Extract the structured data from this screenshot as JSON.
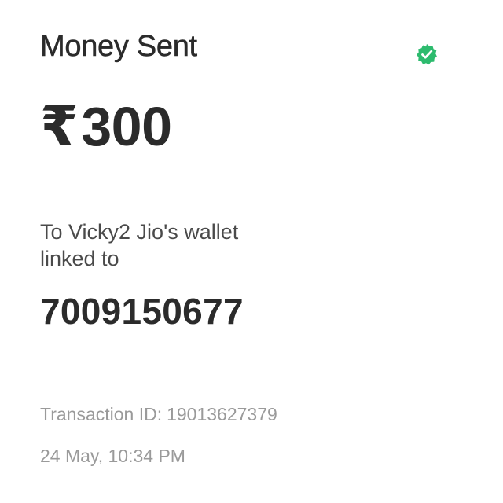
{
  "receipt": {
    "title": "Money Sent",
    "status_icon": "verified-check-icon",
    "status_color": "#2dbb6e",
    "currency_symbol": "₹",
    "amount": "300",
    "recipient_line1": "To Vicky2 Jio's wallet",
    "recipient_line2": "linked to",
    "phone_number": "7009150677",
    "transaction_id_label": "Transaction ID:",
    "transaction_id": "19013627379",
    "timestamp": "24 May, 10:34 PM"
  }
}
